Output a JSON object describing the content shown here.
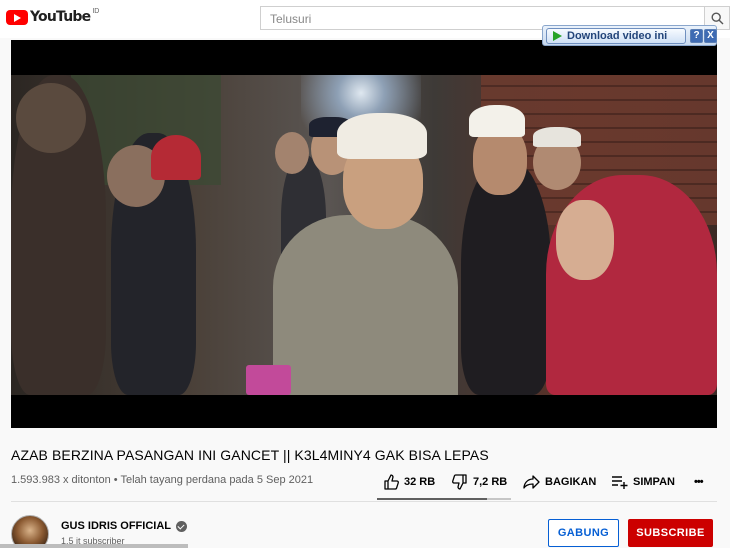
{
  "header": {
    "logo_text": "YouTube",
    "logo_country": "ID",
    "search_placeholder": "Telusuri"
  },
  "download_bar": {
    "button_label": "Download video ini",
    "help_label": "?",
    "close_label": "X"
  },
  "video": {
    "title": "AZAB BERZINA PASANGAN INI GANCET || K3L4MINY4 GAK BISA LEPAS",
    "views_text": "1.593.983 x ditonton • Telah tayang perdana pada 5 Sep 2021"
  },
  "actions": {
    "like_count": "32 RB",
    "dislike_count": "7,2 RB",
    "share_label": "BAGIKAN",
    "save_label": "SIMPAN",
    "more_label": "•••",
    "like_ratio": 0.82
  },
  "channel": {
    "name": "GUS IDRIS OFFICIAL",
    "subscribers": "1,5 jt subscriber",
    "join_label": "GABUNG",
    "subscribe_label": "SUBSCRIBE"
  },
  "colors": {
    "brand_red": "#ff0000",
    "subscribe_red": "#cc0000",
    "join_blue": "#065fd4"
  }
}
